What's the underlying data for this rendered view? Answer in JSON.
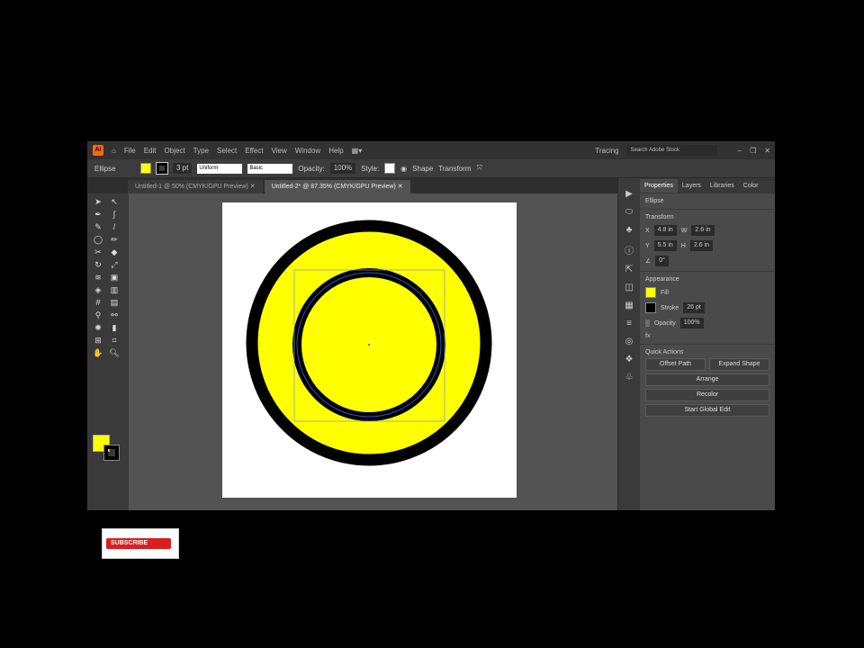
{
  "menu": {
    "items": [
      "File",
      "Edit",
      "Object",
      "Type",
      "Select",
      "Effect",
      "View",
      "Window",
      "Help"
    ],
    "workspace": "Tracing",
    "search_placeholder": "Search Adobe Stock"
  },
  "control": {
    "label": "Ellipse",
    "stroke_weight": "3 pt",
    "profile": "Uniform",
    "brush": "Basic",
    "opacity_label": "Opacity:",
    "opacity": "100%",
    "style_label": "Style:",
    "transform": "Transform",
    "align": "Shape"
  },
  "tabs": [
    {
      "label": "Untitled-1 @ 50% (CMYK/GPU Preview)"
    },
    {
      "label": "Untitled-2* @ 87.35% (CMYK/GPU Preview)"
    }
  ],
  "panel": {
    "tabs": [
      "Properties",
      "Layers",
      "Libraries",
      "Color"
    ],
    "object": "Ellipse",
    "transform_title": "Transform",
    "x": "4.8 in",
    "y": "5.5 in",
    "w": "2.6 in",
    "h": "2.6 in",
    "angle": "0°",
    "appearance_title": "Appearance",
    "fill": "Fill",
    "stroke": "Stroke",
    "stroke_value": "26 pt",
    "opacity": "Opacity",
    "opacity_value": "100%",
    "quick_title": "Quick Actions",
    "offset": "Offset Path",
    "expand": "Expand Shape",
    "arrange": "Arrange",
    "recolor": "Recolor",
    "global_edit": "Start Global Edit"
  },
  "subscribe": "SUBSCRIBE",
  "colors": {
    "fill": "#ffff00",
    "stroke": "#000000"
  }
}
